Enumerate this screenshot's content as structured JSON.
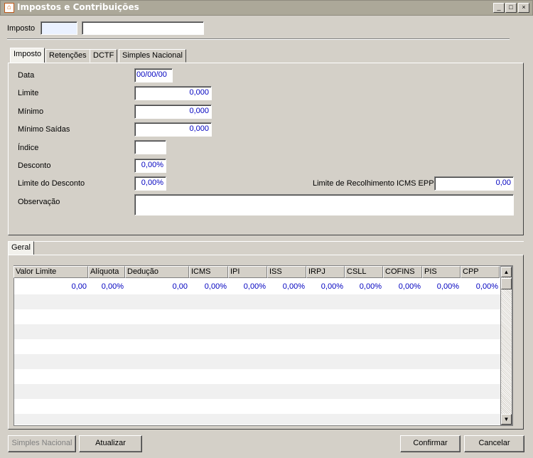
{
  "window": {
    "title": "Impostos e Contribuições",
    "minimize": "_",
    "maximize": "□",
    "close": "×"
  },
  "header": {
    "imposto_label": "Imposto",
    "code_value": "",
    "name_value": ""
  },
  "tabs": [
    "Imposto",
    "Retenções",
    "DCTF",
    "Simples Nacional"
  ],
  "form": {
    "data_label": "Data",
    "data_value": "00/00/00",
    "limite_label": "Limite",
    "limite_value": "0,000",
    "minimo_label": "Mínimo",
    "minimo_value": "0,000",
    "minimo_saidas_label": "Mínimo Saídas",
    "minimo_saidas_value": "0,000",
    "indice_label": "Índice",
    "indice_value": "",
    "desconto_label": "Desconto",
    "desconto_value": "0,00%",
    "limite_desconto_label": "Limite do Desconto",
    "limite_desconto_value": "0,00%",
    "limite_recolhimento_label": "Limite de Recolhimento ICMS EPP",
    "limite_recolhimento_value": "0,00",
    "observacao_label": "Observação",
    "observacao_value": ""
  },
  "lower_tab": "Geral",
  "grid": {
    "columns": [
      "Valor Limite",
      "Alíquota",
      "Dedução",
      "ICMS",
      "IPI",
      "ISS",
      "IRPJ",
      "CSLL",
      "COFINS",
      "PIS",
      "CPP"
    ],
    "row": [
      "0,00",
      "0,00%",
      "0,00",
      "0,00%",
      "0,00%",
      "0,00%",
      "0,00%",
      "0,00%",
      "0,00%",
      "0,00%",
      "0,00%"
    ]
  },
  "scroll": {
    "up": "▲",
    "down": "▼"
  },
  "buttons": {
    "simples_nacional": "Simples Nacional",
    "atualizar": "Atualizar",
    "confirmar": "Confirmar",
    "cancelar": "Cancelar"
  },
  "colors": {
    "title_bg": "#aca899",
    "value_text": "#0000c0",
    "stripe": "#f0f0f0"
  }
}
